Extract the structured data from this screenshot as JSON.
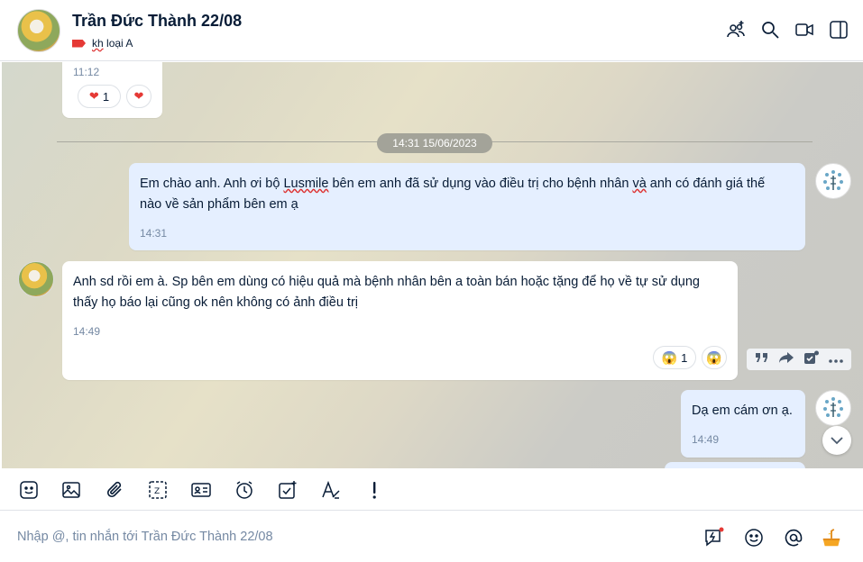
{
  "header": {
    "title": "Trần Đức Thành 22/08",
    "tag_underlined": "kh",
    "tag_rest": " loại A",
    "tag_color": "#e53935"
  },
  "messages": {
    "prev": {
      "time": "11:12",
      "reaction_count": "1"
    },
    "date_divider": "14:31 15/06/2023",
    "m1": {
      "line1_a": "Em chào anh. Anh ơi bộ ",
      "line1_u1": "Lusmile",
      "line1_b": " bên em anh đã sử dụng vào điều trị cho bệnh nhân ",
      "line1_u2": "và",
      "line1_c": " anh có đánh giá thế",
      "line2": "nào về sản phẩm bên em ạ",
      "time": "14:31"
    },
    "m2": {
      "line1": "Anh sd rồi em à. Sp bên em dùng có hiệu quả mà bệnh nhân bên a toàn bán hoặc tặng để họ về tự sử dụng",
      "line2": "thấy họ báo lại cũng ok nên không có ảnh điều trị",
      "time": "14:49",
      "reaction_count": "1"
    },
    "m3": {
      "text": "Dạ em cám ơn ạ.",
      "time": "14:49"
    }
  },
  "composer": {
    "placeholder": "Nhập @, tin nhắn tới Trần Đức Thành 22/08"
  },
  "icons": {
    "header": [
      "add-member-icon",
      "search-icon",
      "video-call-icon",
      "sidebar-toggle-icon"
    ],
    "toolbar": [
      "sticker-icon",
      "image-icon",
      "attach-icon",
      "screenshot-icon",
      "contact-card-icon",
      "reminder-icon",
      "task-icon",
      "format-text-icon",
      "important-icon"
    ],
    "composer": [
      "quick-message-icon",
      "emoji-icon",
      "mention-icon",
      "reaction-icon"
    ]
  },
  "colors": {
    "accent": "#0068ff",
    "outgoing_bubble": "#e5efff",
    "date_pill": "#a3a399"
  }
}
